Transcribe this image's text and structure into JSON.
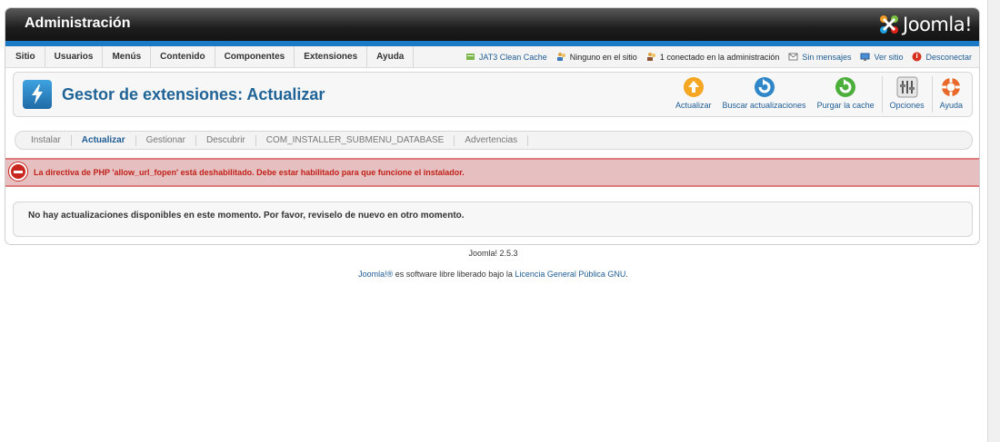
{
  "header": {
    "title": "Administración",
    "logo_text": "Joomla!"
  },
  "menu": {
    "items": [
      "Sitio",
      "Usuarios",
      "Menús",
      "Contenido",
      "Componentes",
      "Extensiones",
      "Ayuda"
    ]
  },
  "status": {
    "cache": "JAT3 Clean Cache",
    "site_users": "Ninguno en el sitio",
    "admin_users": "1 conectado en la administración",
    "messages": "Sin mensajes",
    "view_site": "Ver sitio",
    "logout": "Desconectar"
  },
  "toolbar": {
    "page_title": "Gestor de extensiones: Actualizar",
    "buttons": {
      "update": "Actualizar",
      "find_updates": "Buscar actualizaciones",
      "purge_cache": "Purgar la cache",
      "options": "Opciones",
      "help": "Ayuda"
    }
  },
  "subnav": {
    "items": [
      "Instalar",
      "Actualizar",
      "Gestionar",
      "Descubrir",
      "COM_INSTALLER_SUBMENU_DATABASE",
      "Advertencias"
    ],
    "active": "Actualizar"
  },
  "error": {
    "message": "La directiva de PHP 'allow_url_fopen' está deshabilitado. Debe estar habilitado para que funcione el instalador."
  },
  "message": {
    "text": "No hay actualizaciones disponibles en este momento. Por favor, reviselo de nuevo en otro momento."
  },
  "footer": {
    "version": "Joomla! 2.5.3",
    "link_joomla": "Joomla!®",
    "license_middle": " es software libre liberado bajo la ",
    "link_license": "Licencia General Pública GNU",
    "license_end": "."
  },
  "colors": {
    "accent_blue": "#1b79c6",
    "title_blue": "#1f6397",
    "error_red": "#c0211a",
    "error_bg": "#e6c0c0"
  }
}
